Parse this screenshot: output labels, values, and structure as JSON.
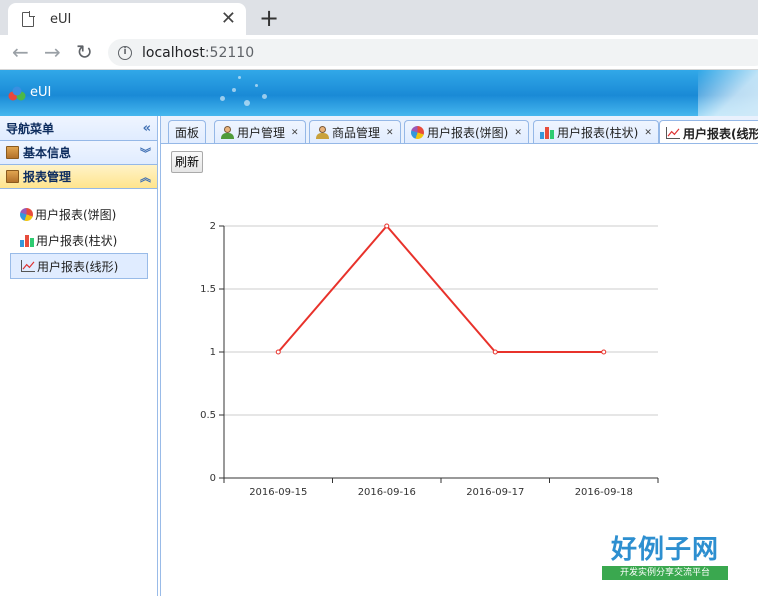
{
  "browser": {
    "tab_title": "eUI",
    "new_tab": "+",
    "close": "✕",
    "url_host": "localhost",
    "url_port": ":52110"
  },
  "header": {
    "title": "eUI"
  },
  "nav": {
    "title": "导航菜单",
    "sections": [
      {
        "label": "基本信息",
        "expanded": false
      },
      {
        "label": "报表管理",
        "expanded": true
      }
    ],
    "items": [
      {
        "label": "用户报表(饼图)",
        "icon": "pie-chart-icon"
      },
      {
        "label": "用户报表(柱状)",
        "icon": "bar-chart-icon"
      },
      {
        "label": "用户报表(线形)",
        "icon": "line-chart-icon",
        "selected": true
      }
    ]
  },
  "tabs": [
    {
      "label": "面板",
      "icon": "",
      "closable": false
    },
    {
      "label": "用户管理",
      "icon": "user-icon",
      "closable": true
    },
    {
      "label": "商品管理",
      "icon": "user-icon",
      "closable": true
    },
    {
      "label": "用户报表(饼图)",
      "icon": "pie-chart-icon",
      "closable": true
    },
    {
      "label": "用户报表(柱状)",
      "icon": "bar-chart-icon",
      "closable": true
    },
    {
      "label": "用户报表(线形)",
      "icon": "line-chart-icon",
      "closable": true,
      "active": true
    }
  ],
  "toolbar": {
    "refresh_label": "刷新"
  },
  "chart_data": {
    "type": "line",
    "x": [
      "2016-09-15",
      "2016-09-16",
      "2016-09-17",
      "2016-09-18"
    ],
    "series": [
      {
        "values": [
          1,
          2,
          1,
          1
        ],
        "color": "#e8322b"
      }
    ],
    "ylim": [
      0,
      2
    ],
    "yticks": [
      "0",
      "0.5",
      "1",
      "1.5",
      "2"
    ],
    "grid": true
  },
  "watermark": {
    "brand": "好例子网",
    "slogan": "开发实例分享交流平台"
  }
}
